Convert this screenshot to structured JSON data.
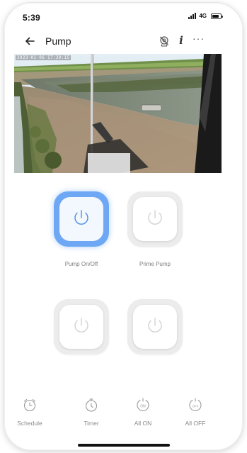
{
  "status_bar": {
    "time": "5:39",
    "network": "4G"
  },
  "header": {
    "title": "Pump",
    "icons": [
      "back-arrow-icon",
      "camera-off-icon",
      "info-icon",
      "more-icon"
    ],
    "info_glyph": "i",
    "more_glyph": "···"
  },
  "camera": {
    "timestamp": "2023-01-06 17:39:15"
  },
  "controls": [
    {
      "label": "Pump On/Off",
      "state": "on",
      "icon": "power-icon"
    },
    {
      "label": "Prime Pump",
      "state": "off",
      "icon": "power-icon"
    },
    {
      "label": "",
      "state": "off",
      "icon": "power-icon"
    },
    {
      "label": "",
      "state": "off",
      "icon": "power-icon"
    }
  ],
  "tabs": [
    {
      "label": "Schedule",
      "icon": "alarm-clock-icon"
    },
    {
      "label": "Timer",
      "icon": "stopwatch-icon"
    },
    {
      "label": "All ON",
      "icon": "all-on-icon",
      "glyph": "ON"
    },
    {
      "label": "All OFF",
      "icon": "all-off-icon",
      "glyph": "OFF"
    }
  ],
  "colors": {
    "accent": "#6ea8f5",
    "power_icon_on": "#4d8fe8",
    "power_icon_off": "#d2d2d2",
    "label": "#7d7d7d"
  }
}
